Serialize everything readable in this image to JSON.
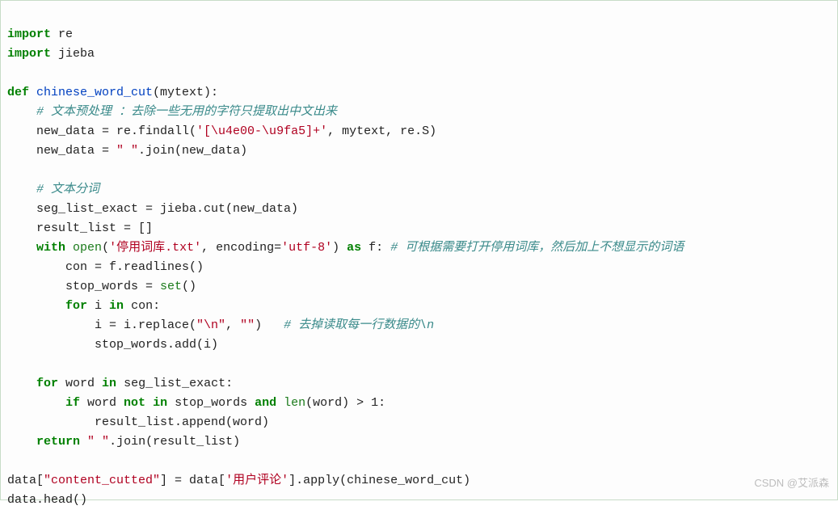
{
  "code": {
    "l01_kw1": "import",
    "l01_mod": " re",
    "l02_kw1": "import",
    "l02_mod": " jieba",
    "l03": "",
    "l04_kw1": "def",
    "l04_fn": " chinese_word_cut",
    "l04_params": "(mytext):",
    "l05_cmt": "    # 文本预处理 ：去除一些无用的字符只提取出中文出来",
    "l06_a": "    new_data = re.findall(",
    "l06_str": "'[\\u4e00-\\u9fa5]+'",
    "l06_b": ", mytext, re.S)",
    "l07_a": "    new_data = ",
    "l07_str": "\" \"",
    "l07_b": ".join(new_data)",
    "l08": "",
    "l09_cmt": "    # 文本分词",
    "l10": "    seg_list_exact = jieba.cut(new_data)",
    "l11": "    result_list = []",
    "l12_a": "    ",
    "l12_kw1": "with",
    "l12_b": " ",
    "l12_bi1": "open",
    "l12_c": "(",
    "l12_str1": "'停用词库.txt'",
    "l12_d": ", encoding=",
    "l12_str2": "'utf-8'",
    "l12_e": ") ",
    "l12_kw2": "as",
    "l12_f": " f: ",
    "l12_cmt": "# 可根据需要打开停用词库，然后加上不想显示的词语",
    "l13": "        con = f.readlines()",
    "l14_a": "        stop_words = ",
    "l14_bi": "set",
    "l14_b": "()",
    "l15_a": "        ",
    "l15_kw1": "for",
    "l15_b": " i ",
    "l15_kw2": "in",
    "l15_c": " con:",
    "l16_a": "            i = i.replace(",
    "l16_str1": "\"\\n\"",
    "l16_b": ", ",
    "l16_str2": "\"\"",
    "l16_c": ")   ",
    "l16_cmt": "# 去掉读取每一行数据的\\n",
    "l17": "            stop_words.add(i)",
    "l18": "",
    "l19_a": "    ",
    "l19_kw1": "for",
    "l19_b": " word ",
    "l19_kw2": "in",
    "l19_c": " seg_list_exact:",
    "l20_a": "        ",
    "l20_kw1": "if",
    "l20_b": " word ",
    "l20_kw2": "not",
    "l20_c": " ",
    "l20_kw3": "in",
    "l20_d": " stop_words ",
    "l20_kw4": "and",
    "l20_e": " ",
    "l20_bi": "len",
    "l20_f": "(word) > 1:",
    "l21": "            result_list.append(word)",
    "l22_a": "    ",
    "l22_kw1": "return",
    "l22_b": " ",
    "l22_str": "\" \"",
    "l22_c": ".join(result_list)",
    "l23": "",
    "l24_a": "data[",
    "l24_str1": "\"content_cutted\"",
    "l24_b": "] = data[",
    "l24_str2": "'用户评论'",
    "l24_c": "].apply(chinese_word_cut)",
    "l25": "data.head()"
  },
  "watermark": "CSDN @艾派森"
}
